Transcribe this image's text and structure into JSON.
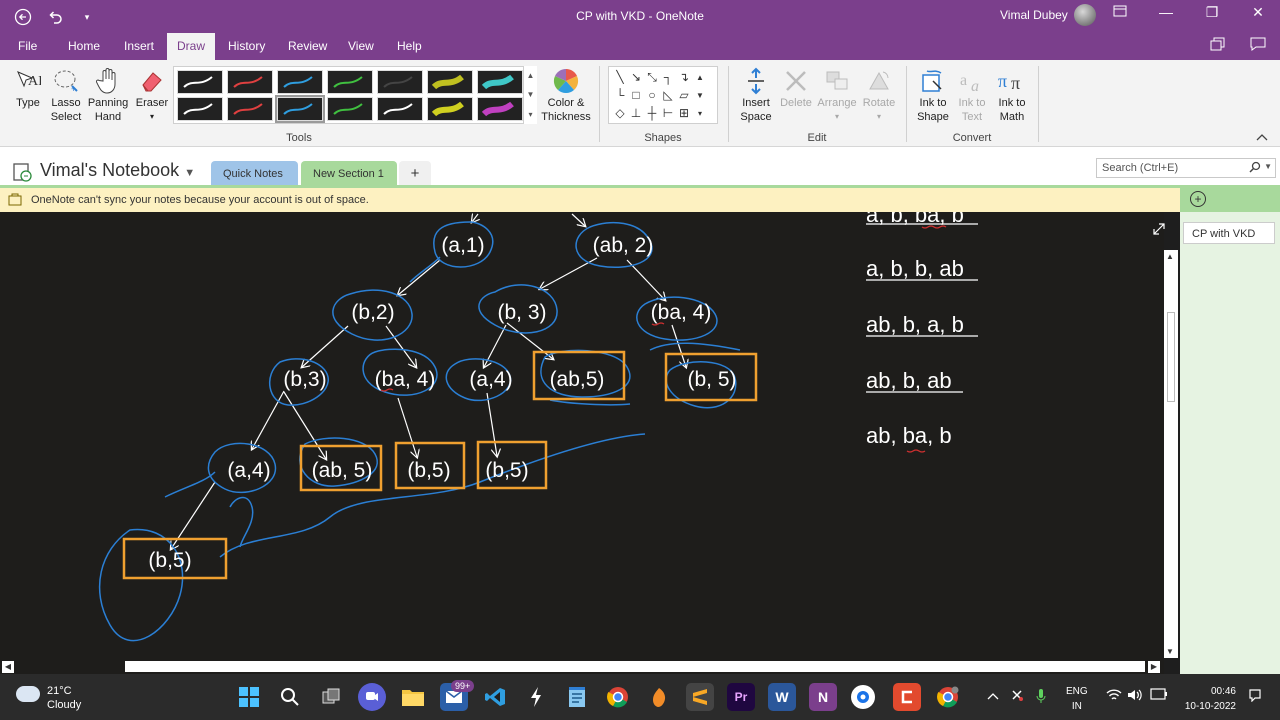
{
  "titlebar": {
    "title": "CP with VKD  -  OneNote",
    "user": "Vimal Dubey",
    "back_icon": "back-arrow-icon",
    "undo_icon": "undo-icon",
    "qat_icon": "customize-icon",
    "ribbon_display_icon": "ribbon-display-icon",
    "minimize_glyph": "—",
    "maximize_glyph": "❐",
    "close_glyph": "✕"
  },
  "menu": {
    "items": [
      "File",
      "Home",
      "Insert",
      "Draw",
      "History",
      "Review",
      "View",
      "Help"
    ],
    "active": "Draw"
  },
  "ribbon": {
    "type_label": "Type",
    "lasso_label": "Lasso Select",
    "panning_label": "Panning Hand",
    "eraser_label": "Eraser",
    "tools_label": "Tools",
    "color_label": "Color & Thickness",
    "shapes_label": "Shapes",
    "insert_space_label": "Insert Space",
    "delete_label": "Delete",
    "arrange_label": "Arrange",
    "rotate_label": "Rotate",
    "edit_label": "Edit",
    "ink_to_shape_label": "Ink to Shape",
    "ink_to_text_label": "Ink to Text",
    "ink_to_math_label": "Ink to Math",
    "convert_label": "Convert",
    "pen_colors": [
      "#ffffff",
      "#e04040",
      "#2f9ee0",
      "#40c040",
      "#444444",
      "#c0c020",
      "#3fc7c7",
      "#ffffff",
      "#e04040",
      "#2f9ee0",
      "#40c040",
      "#ffffff",
      "#d0d020",
      "#c040c0"
    ]
  },
  "notebook": {
    "name": "Vimal's Notebook",
    "sections": [
      "Quick Notes",
      "New Section 1"
    ],
    "add_glyph": "+",
    "search_placeholder": "Search (Ctrl+E)"
  },
  "infobar": {
    "message": "OneNote can't sync your notes because your account is out of space."
  },
  "pages": {
    "add_glyph": "+",
    "items": [
      "CP with VKD"
    ]
  },
  "diagram": {
    "ink_color": "#2b7fd4",
    "box_color": "#f0a030",
    "nodes": [
      {
        "id": "n1",
        "label": "(a,1)"
      },
      {
        "id": "n2",
        "label": "(ab, 2)"
      },
      {
        "id": "n3",
        "label": "(b,2)"
      },
      {
        "id": "n4",
        "label": "(b, 3)"
      },
      {
        "id": "n5",
        "label": "(ba, 4)"
      },
      {
        "id": "n6",
        "label": "(b,3)"
      },
      {
        "id": "n7",
        "label": "(ba, 4)"
      },
      {
        "id": "n8",
        "label": "(a,4)"
      },
      {
        "id": "n9",
        "label": "(ab,5)"
      },
      {
        "id": "n10",
        "label": "(b, 5)"
      },
      {
        "id": "n11",
        "label": "(a,4)"
      },
      {
        "id": "n12",
        "label": "(ab, 5)"
      },
      {
        "id": "n13",
        "label": "(b,5)"
      },
      {
        "id": "n14",
        "label": "(b,5)"
      },
      {
        "id": "n15",
        "label": "(b,5)"
      }
    ],
    "results": [
      "a, b, ba, b",
      "a, b, b, ab",
      "ab, b, a, b",
      "ab, b, ab",
      "ab, ba, b"
    ]
  },
  "taskbar": {
    "temp": "21°C",
    "condition": "Cloudy",
    "badge": "99+",
    "lang_top": "ENG",
    "lang_bottom": "IN",
    "time": "00:46",
    "date": "10-10-2022"
  }
}
